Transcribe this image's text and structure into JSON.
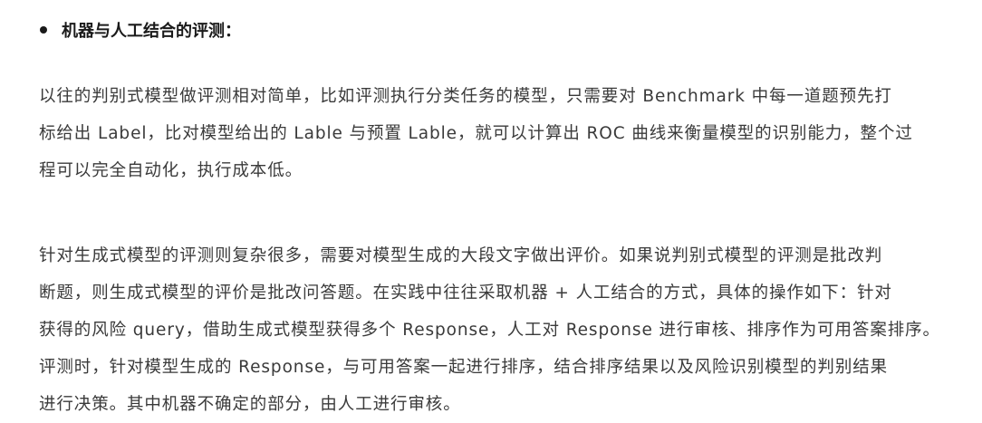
{
  "heading": "机器与人工结合的评测：",
  "paragraph1": [
    "以往的判别式模型做评测相对简单，比如评测执行分类任务的模型，只需要对 Benchmark 中每一道题预先打",
    "标给出 Label，比对模型给出的 Lable 与预置 Lable，就可以计算出 ROC 曲线来衡量模型的识别能力，整个过",
    "程可以完全自动化，执行成本低。"
  ],
  "paragraph2": [
    "针对生成式模型的评测则复杂很多，需要对模型生成的大段文字做出评价。如果说判别式模型的评测是批改判",
    "断题，则生成式模型的评价是批改问答题。在实践中往往采取机器 + 人工结合的方式，具体的操作如下：针对",
    "获得的风险 query，借助生成式模型获得多个 Response，人工对 Response 进行审核、排序作为可用答案排序。",
    "评测时，针对模型生成的 Response，与可用答案一起进行排序，结合排序结果以及风险识别模型的判别结果",
    "进行决策。其中机器不确定的部分，由人工进行审核。"
  ]
}
